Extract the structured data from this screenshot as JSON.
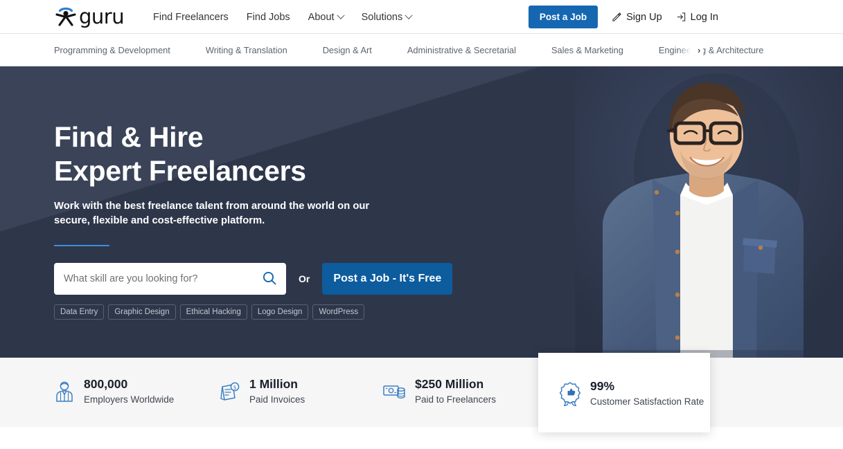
{
  "brand": {
    "name": "guru",
    "logo_icon": "guru-person-logo",
    "accent_blue": "#1567b1",
    "mark_blue": "#2f7fd0"
  },
  "header": {
    "nav": [
      {
        "label": "Find Freelancers",
        "has_caret": false,
        "icon": ""
      },
      {
        "label": "Find Jobs",
        "has_caret": false,
        "icon": ""
      },
      {
        "label": "About",
        "has_caret": true,
        "icon": "chevron-down-icon"
      },
      {
        "label": "Solutions",
        "has_caret": true,
        "icon": "chevron-down-icon"
      }
    ],
    "post_job_label": "Post a Job",
    "sign_up_label": "Sign Up",
    "sign_up_icon": "pencil-edit-icon",
    "log_in_label": "Log In",
    "log_in_icon": "login-arrow-icon"
  },
  "categories": {
    "items": [
      "Programming & Development",
      "Writing & Translation",
      "Design & Art",
      "Administrative & Secretarial",
      "Sales & Marketing",
      "Engineering & Architecture"
    ],
    "next_icon": "chevron-right-icon",
    "next_label": "›"
  },
  "hero": {
    "title_line1": "Find & Hire",
    "title_line2": "Expert Freelancers",
    "subtitle": "Work with the best freelance talent from around the world on our secure, flexible and cost-effective platform.",
    "background_color": "#333c52",
    "rule_color": "#3f8ee0",
    "search": {
      "placeholder": "What skill are you looking for?",
      "value": "",
      "icon": "search-icon"
    },
    "or_label": "Or",
    "cta_label": "Post a Job - It's Free",
    "cta_color": "#0c5c9e",
    "chips": [
      "Data Entry",
      "Graphic Design",
      "Ethical Hacking",
      "Logo Design",
      "WordPress"
    ],
    "photo_alt": "smiling-man-with-glasses-denim-shirt"
  },
  "stats": {
    "background_color": "#f6f6f6",
    "items": [
      {
        "icon": "employer-person-icon",
        "value": "800,000",
        "label": "Employers Worldwide"
      },
      {
        "icon": "invoice-dollar-icon",
        "value": "1 Million",
        "label": "Paid Invoices"
      },
      {
        "icon": "cash-money-icon",
        "value": "$250 Million",
        "label": "Paid to Freelancers"
      },
      {
        "icon": "ribbon-thumbsup-icon",
        "value": "99%",
        "label": "Customer Satisfaction Rate"
      }
    ]
  }
}
